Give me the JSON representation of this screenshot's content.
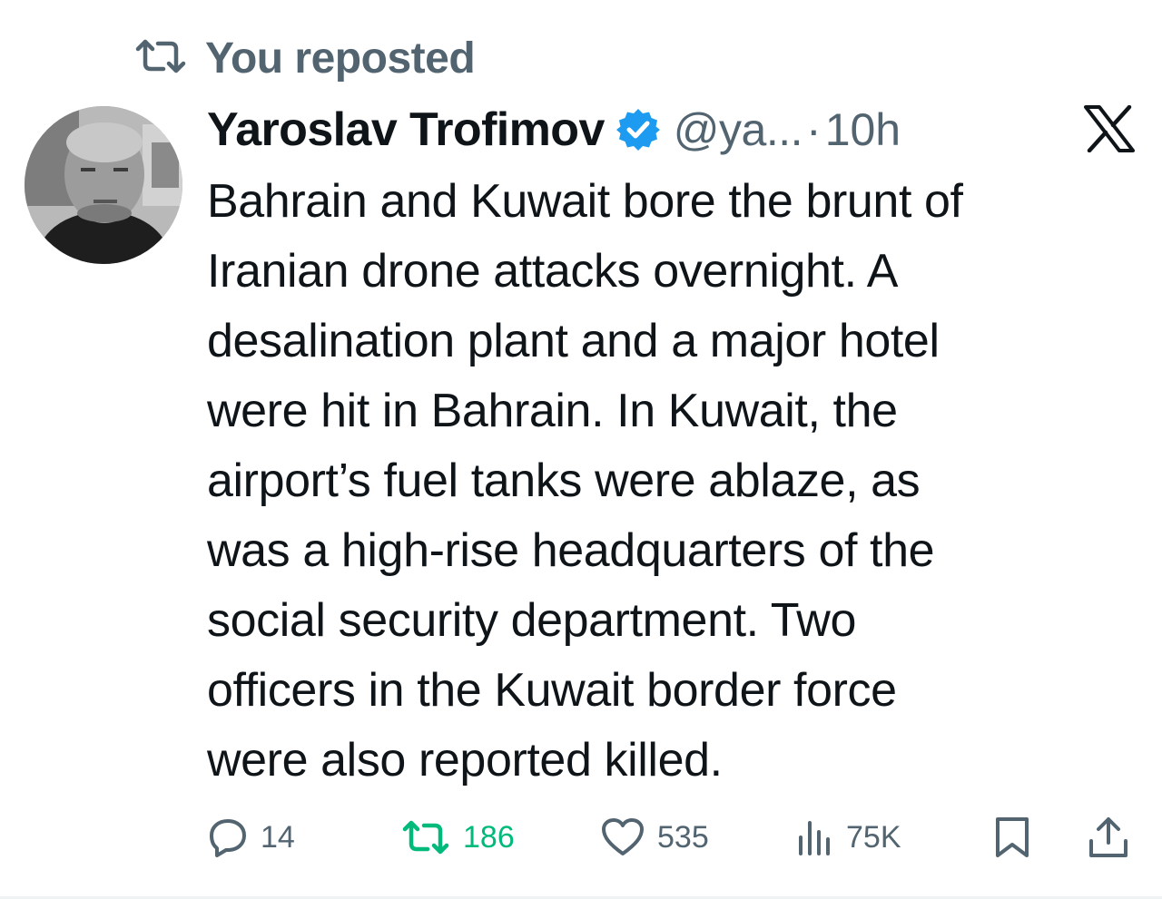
{
  "repost_banner": {
    "label": "You reposted",
    "icon": "repost-icon"
  },
  "author": {
    "name": "Yaroslav Trofimov",
    "verified": true,
    "handle": "@ya...",
    "separator": "·",
    "time": "10h",
    "avatar": "avatar-photo"
  },
  "platform_icon": "x-logo-icon",
  "tweet": {
    "lines": [
      "Bahrain and Kuwait bore the brunt of",
      "Iranian drone attacks overnight. A",
      "desalination plant and a major hotel",
      "were hit in Bahrain. In Kuwait, the",
      "airport’s fuel tanks were ablaze, as",
      "was a high-rise headquarters of the",
      "social security department. Two",
      "officers in the Kuwait border force",
      "were also reported killed."
    ]
  },
  "actions": {
    "replies": "14",
    "reposts": "186",
    "likes": "535",
    "views": "75K",
    "bookmark_icon": "bookmark-icon",
    "share_icon": "share-icon"
  },
  "colors": {
    "text_primary": "#0f1419",
    "text_secondary": "#536471",
    "verified_blue": "#1d9bf0",
    "repost_green": "#00ba7c"
  }
}
